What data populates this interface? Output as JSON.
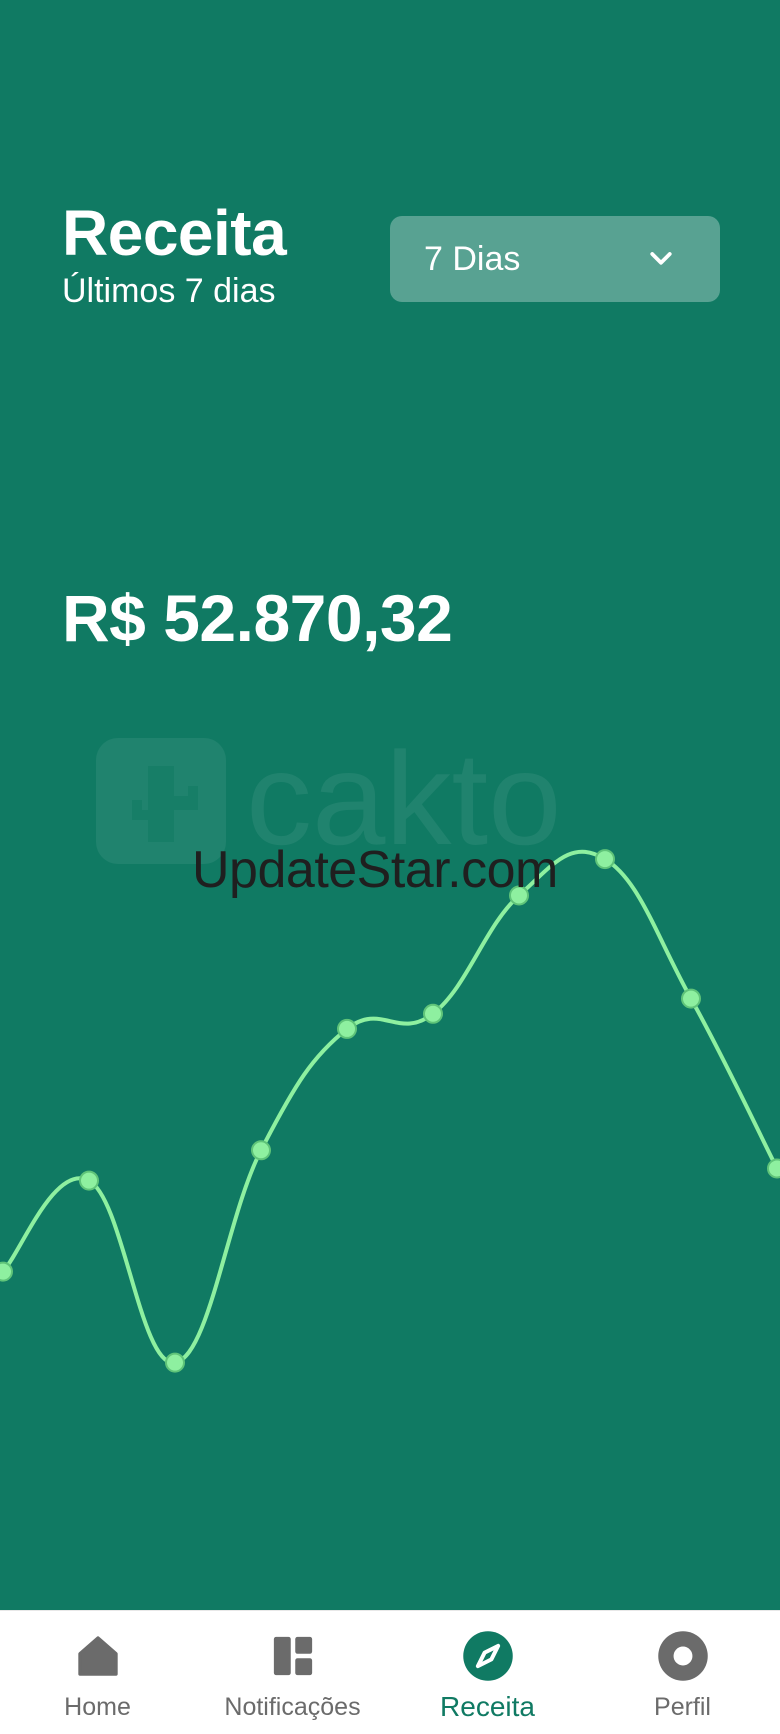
{
  "header": {
    "title": "Receita",
    "subtitle": "Últimos 7 dias"
  },
  "period_select": {
    "selected": "7 Dias",
    "icon": "chevron-down-icon"
  },
  "total": {
    "amount": "R$ 52.870,32"
  },
  "watermarks": {
    "brand": "cakto",
    "overlay": "UpdateStar.com"
  },
  "chart_data": {
    "type": "line",
    "title": "",
    "xlabel": "",
    "ylabel": "",
    "series": [
      {
        "values": [
          0.36,
          0.51,
          0.21,
          0.56,
          0.76,
          0.785,
          0.98,
          1.04,
          0.81,
          0.53
        ]
      }
    ],
    "ylim": [
      0,
      1.2
    ],
    "grid": false,
    "line_color": "#8ef0a0",
    "point_color": "#8ef0a0"
  },
  "nav": {
    "items": [
      {
        "label": "Home",
        "icon": "home-icon",
        "active": false
      },
      {
        "label": "Notificações",
        "icon": "grid-icon",
        "active": false
      },
      {
        "label": "Receita",
        "icon": "compass-icon",
        "active": true
      },
      {
        "label": "Perfil",
        "icon": "profile-icon",
        "active": false
      }
    ]
  },
  "colors": {
    "background": "#107a63",
    "accent": "#107a63",
    "nav_inactive": "#6b6b6b"
  }
}
